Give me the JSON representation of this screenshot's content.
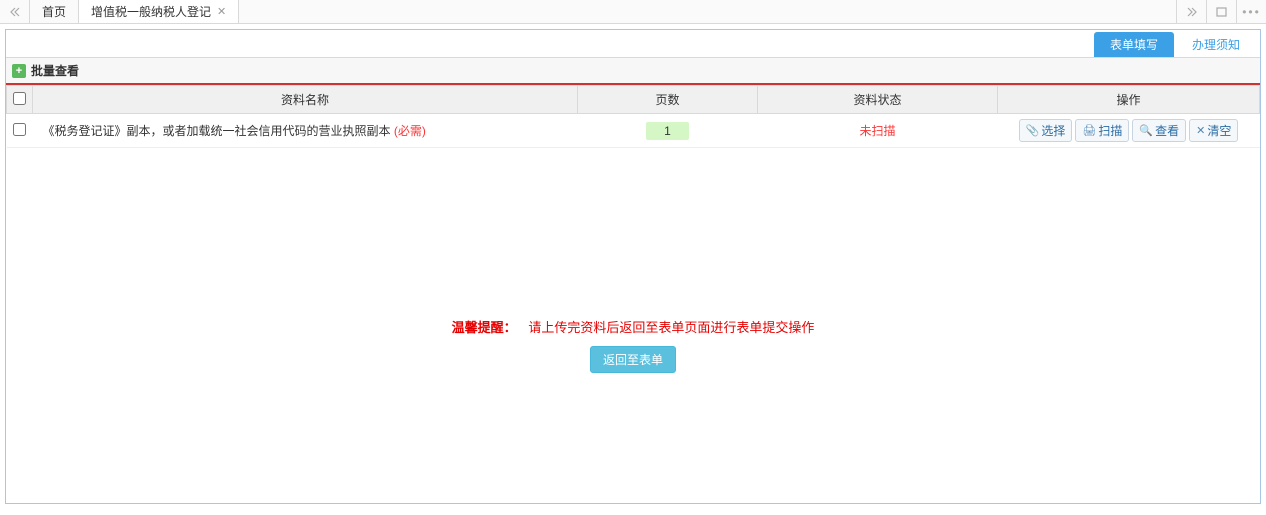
{
  "tabs": {
    "home": "首页",
    "active": "增值税一般纳税人登记"
  },
  "pillTabs": {
    "form": "表单填写",
    "notice": "办理须知"
  },
  "section": {
    "title": "批量查看"
  },
  "table": {
    "headers": {
      "name": "资料名称",
      "pages": "页数",
      "status": "资料状态",
      "actions": "操作"
    },
    "rows": [
      {
        "name": "《税务登记证》副本，或者加载统一社会信用代码的营业执照副本",
        "required": "(必需)",
        "pages": "1",
        "status": "未扫描"
      }
    ]
  },
  "actions": {
    "select": "选择",
    "scan": "扫描",
    "view": "查看",
    "clear": "清空"
  },
  "footer": {
    "reminderLabel": "温馨提醒：",
    "reminderText": "请上传完资料后返回至表单页面进行表单提交操作",
    "returnBtn": "返回至表单"
  }
}
